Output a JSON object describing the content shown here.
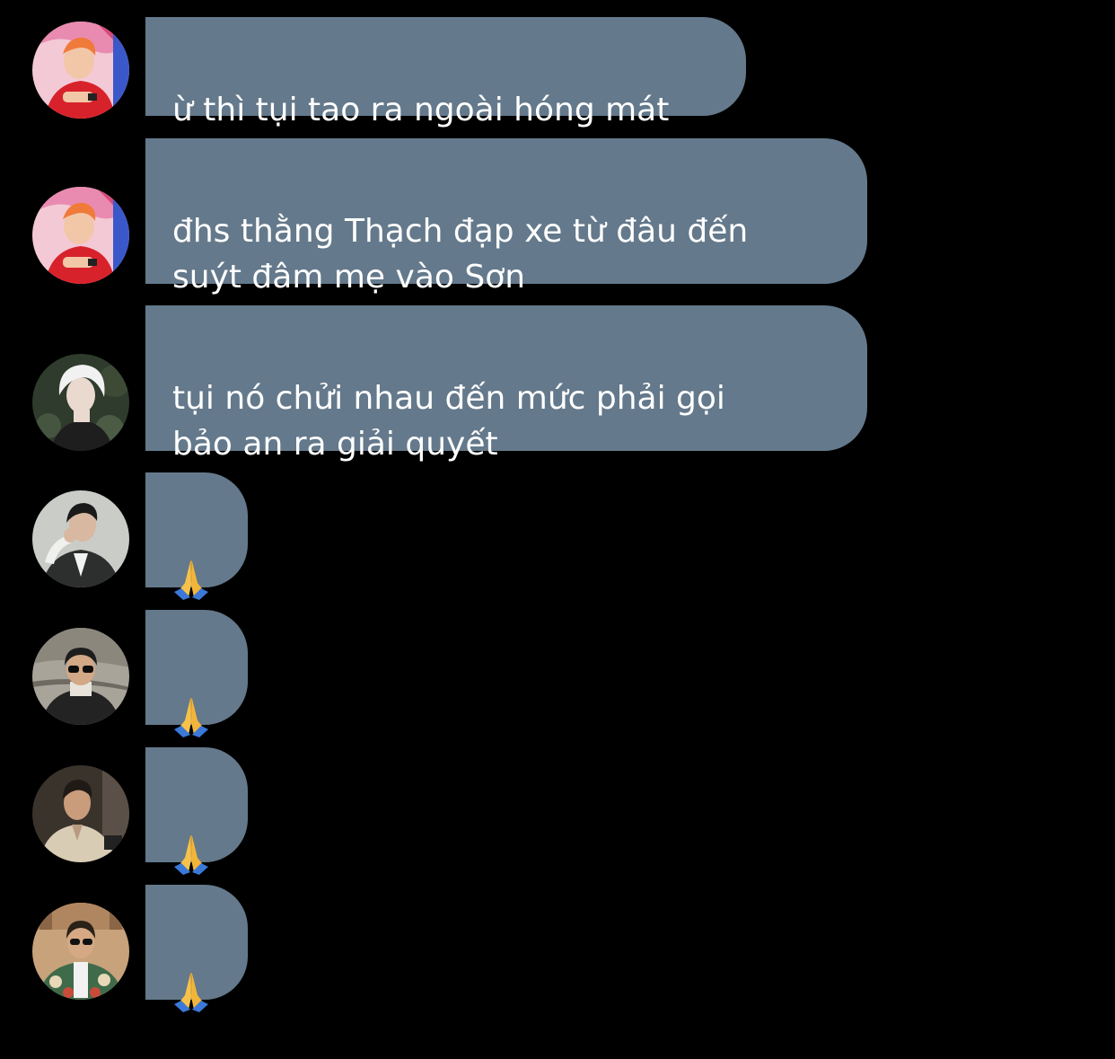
{
  "colors": {
    "background": "#000000",
    "bubble": "#64798b",
    "text": "#ffffff"
  },
  "messages": [
    {
      "sender_avatar": "avatar-pink-red-icon",
      "text": "ừ thì tụi tao ra ngoài hóng mát"
    },
    {
      "sender_avatar": "avatar-pink-red-icon",
      "text": "đhs thằng Thạch đạp xe từ đâu đến\nsuýt đâm mẹ vào Sơn"
    },
    {
      "sender_avatar": "avatar-white-hair-icon",
      "text": "tụi nó chửi nhau đến mức phải gọi\nbảo an ra giải quyết"
    },
    {
      "sender_avatar": "avatar-suit-pose-icon",
      "emoji": "🙏",
      "emoji_name": "folded-hands-icon"
    },
    {
      "sender_avatar": "avatar-sunglasses-road-icon",
      "emoji": "🙏",
      "emoji_name": "folded-hands-icon"
    },
    {
      "sender_avatar": "avatar-beige-shirt-icon",
      "emoji": "🙏",
      "emoji_name": "folded-hands-icon"
    },
    {
      "sender_avatar": "avatar-floral-shirt-icon",
      "emoji": "🙏",
      "emoji_name": "folded-hands-icon"
    }
  ]
}
